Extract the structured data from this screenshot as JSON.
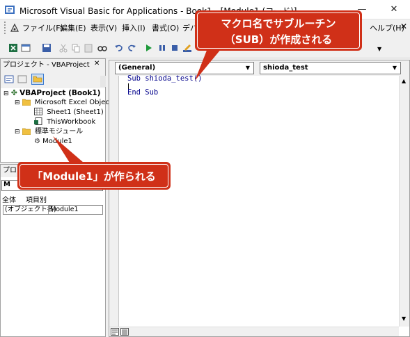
{
  "window": {
    "title": "Microsoft Visual Basic for Applications - Book1 - [Module1 (コード)]",
    "minimize": "—",
    "maximize": "☐",
    "close": "✕"
  },
  "menu": {
    "items": [
      "ファイル(F)",
      "編集(E)",
      "表示(V)",
      "挿入(I)",
      "書式(O)",
      "デバ"
    ],
    "help": "ヘルプ(H)"
  },
  "project_pane": {
    "title": "プロジェクト - VBAProject",
    "root": "VBAProject (Book1)",
    "folder_objects": "Microsoft Excel Object",
    "sheet1": "Sheet1 (Sheet1)",
    "thisworkbook": "ThisWorkbook",
    "folder_modules": "標準モジュール",
    "module1": "Module1"
  },
  "properties_pane": {
    "title": "プロ",
    "combo_value": "M",
    "tab_all": "全体",
    "tab_category": "項目別",
    "row_name_label": "(オブジェクト名)",
    "row_name_value": "Module1"
  },
  "code_window": {
    "object_combo": "(General)",
    "proc_combo": "shioda_test",
    "line1": "Sub shioda_test()",
    "line3": "End Sub"
  },
  "callouts": {
    "top_line1": "マクロ名でサブルーチン",
    "top_line2": "（SUB）が作成される",
    "left": "「Module1」が作られる"
  },
  "colors": {
    "callout": "#d03018",
    "keyword": "#00008b"
  }
}
